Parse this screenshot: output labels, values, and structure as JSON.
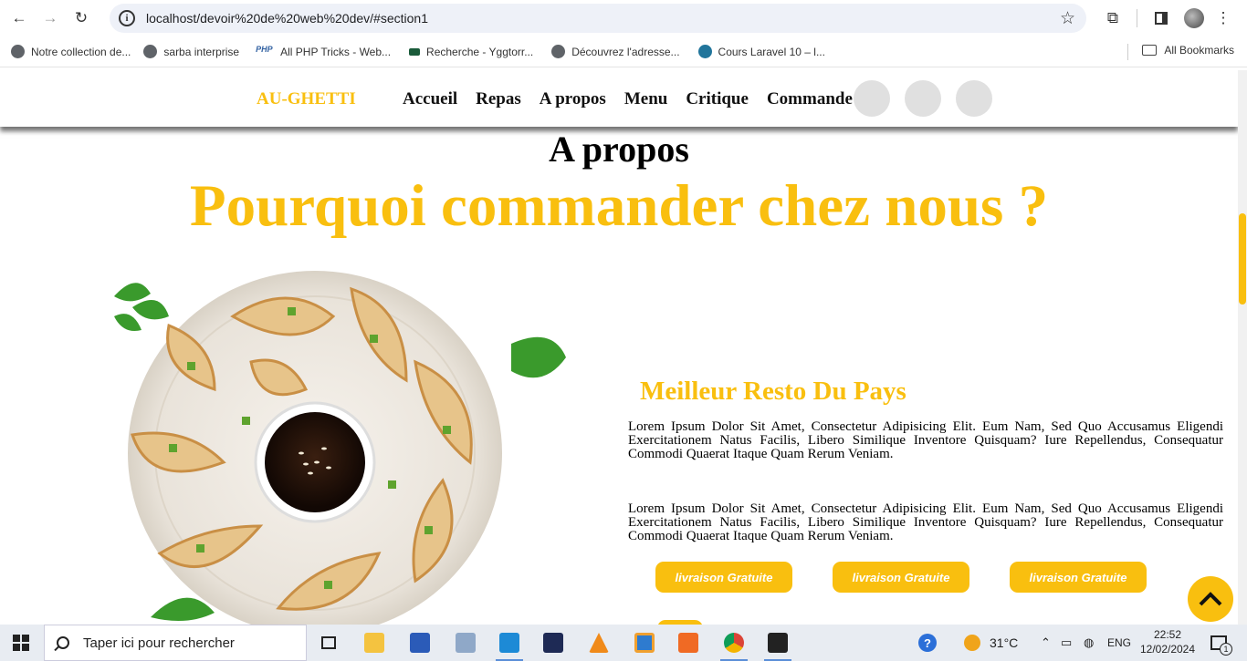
{
  "browser": {
    "url": "localhost/devoir%20de%20web%20dev/#section1",
    "bookmarks": [
      {
        "label": "Notre collection de...",
        "icon": "globe-icon"
      },
      {
        "label": "sarba interprise",
        "icon": "globe-icon"
      },
      {
        "label": "All PHP Tricks - Web...",
        "icon": "php-icon"
      },
      {
        "label": "Recherche - Yggtorr...",
        "icon": "ygg-icon"
      },
      {
        "label": "Découvrez l'adresse...",
        "icon": "globe-icon"
      },
      {
        "label": "Cours Laravel 10 – l...",
        "icon": "wordpress-icon"
      }
    ],
    "all_bookmarks": "All Bookmarks"
  },
  "site": {
    "logo": "AU-GHETTI",
    "menu": [
      "Accueil",
      "Repas",
      "A propos",
      "Menu",
      "Critique",
      "Commande"
    ],
    "section_title": "A propos",
    "hero_title": "Pourquoi commander chez nous ?",
    "subtitle": "Meilleur Resto Du Pays",
    "paragraphs": [
      "Lorem Ipsum Dolor Sit Amet, Consectetur Adipisicing Elit. Eum Nam, Sed Quo Accusamus Eligendi Exercitationem Natus Facilis, Libero Similique Inventore Quisquam? Iure Repellendus, Consequatur Commodi Quaerat Itaque Quam Rerum Veniam.",
      "Lorem Ipsum Dolor Sit Amet, Consectetur Adipisicing Elit. Eum Nam, Sed Quo Accusamus Eligendi Exercitationem Natus Facilis, Libero Similique Inventore Quisquam? Iure Repellendus, Consequatur Commodi Quaerat Itaque Quam Rerum Veniam."
    ],
    "buttons": [
      "livraison Gratuite",
      "livraison Gratuite",
      "livraison Gratuite"
    ],
    "accent_color": "#f9bf0f"
  },
  "taskbar": {
    "search_placeholder": "Taper ici pour rechercher",
    "temperature": "31°C",
    "language": "ENG",
    "time": "22:52",
    "date": "12/02/2024",
    "notification_count": "1"
  }
}
